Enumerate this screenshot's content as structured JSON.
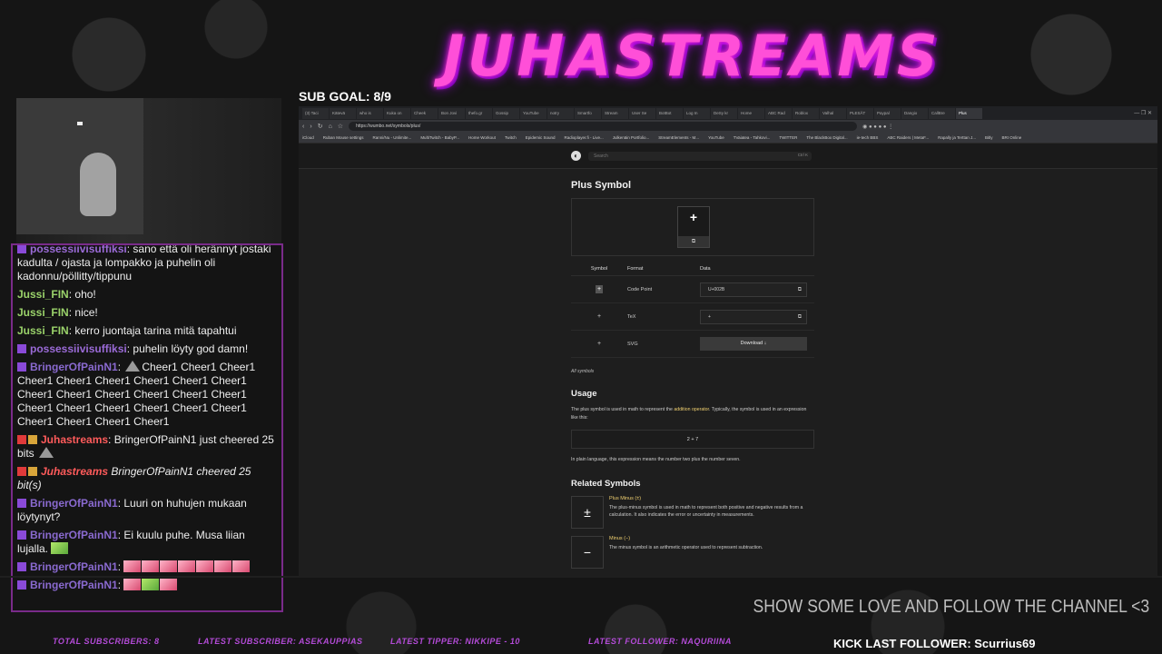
{
  "overlay": {
    "logo_text": "JUHASTREAMS",
    "sub_goal": "SUB GOAL: 8/9",
    "follow_cta": "SHOW SOME LOVE AND FOLLOW THE CHANNEL <3",
    "tickers": {
      "total_subscribers": "TOTAL SUBSCRIBERS: 8",
      "latest_subscriber": "LATEST SUBSCRIBER: ASEKAUPPIAS",
      "latest_tipper": "LATEST TIPPER: NIKKIPE - 10",
      "latest_follower": "LATEST FOLLOWER: NAQURIINA"
    },
    "kick_follower": "KICK LAST FOLLOWER: Scurrius69"
  },
  "chat": [
    {
      "user": "possessiivisuffiksi",
      "sep": ":",
      "text": "sano että oli herännyt jostaki kadulta / ojasta ja lompakko ja puhelin oli kadonnu/pöllitty/tippunu"
    },
    {
      "user": "Jussi_FIN",
      "sep": ":",
      "text": "oho!"
    },
    {
      "user": "Jussi_FIN",
      "sep": ":",
      "text": "nice!"
    },
    {
      "user": "Jussi_FIN",
      "sep": ":",
      "text": "kerro juontaja tarina mitä tapahtui"
    },
    {
      "user": "possessiivisuffiksi",
      "sep": ":",
      "text": "puhelin löyty god damn!"
    },
    {
      "user": "BringerOfPainN1",
      "sep": ":",
      "text": "Cheer1 Cheer1 Cheer1 Cheer1 Cheer1 Cheer1 Cheer1 Cheer1 Cheer1 Cheer1 Cheer1 Cheer1 Cheer1 Cheer1 Cheer1 Cheer1 Cheer1 Cheer1 Cheer1 Cheer1 Cheer1 Cheer1 Cheer1 Cheer1 Cheer1"
    },
    {
      "user": "Juhastreams",
      "sep": ":",
      "text": "BringerOfPainN1 just cheered 25 bits"
    },
    {
      "user": "Juhastreams",
      "sep": "",
      "text": "BringerOfPainN1 cheered 25 bit(s)"
    },
    {
      "user": "BringerOfPainN1",
      "sep": ":",
      "text": "Luuri on huhujen mukaan löytynyt?"
    },
    {
      "user": "BringerOfPainN1",
      "sep": ":",
      "text": "Ei kuulu puhe. Musa liian lujalla."
    },
    {
      "user": "BringerOfPainN1",
      "sep": ":",
      "text": ""
    },
    {
      "user": "BringerOfPainN1",
      "sep": ":",
      "text": ""
    }
  ],
  "browser": {
    "tabs": [
      "(3) Taci",
      "Kätevä",
      "who is",
      "Kuka on",
      "Cheek",
      "Bon Jovi",
      "thefo.gr",
      "Gossip",
      "YouTube",
      "notry",
      "Smartfo",
      "Stream",
      "User Se",
      "BotBot",
      "Log In",
      "DeSy kr",
      "Home",
      "ABC Rad",
      "Roblox",
      "Valhal",
      "PLESÄT",
      "Paypal",
      "Dangio",
      "CallBre",
      "Plus"
    ],
    "url": "https://wumbo.net/symbols/plus/",
    "window_controls": "—  ❐  ✕",
    "bookmarks": [
      "iCloud",
      "Ruban Mouse settings",
      "Ranni/Nu - Unlimite...",
      "MultiTwitch - BabyP...",
      "Home Workout",
      "Twitch",
      "Epidemic Sound",
      "Radioplayer.fi - Live...",
      "Julkenäin Portfolio...",
      "StreamElements - M...",
      "YouTube",
      "TVaiatea - Tahkovi...",
      "TWITTER",
      "The BlackBox Digital...",
      "ie-tech BBS",
      "ABC Raiders | MetaF...",
      "Rapally ja Terttan J...",
      "Bitly",
      "BRI Online"
    ],
    "site_search_placeholder": "Search",
    "site_search_shortcut": "Ctrl K",
    "page": {
      "title": "Plus Symbol",
      "preview_symbol": "+",
      "table_headers": [
        "Symbol",
        "Format",
        "Data"
      ],
      "rows": [
        {
          "symbol": "+",
          "format": "Code Point",
          "data": "U+002B",
          "kind": "input"
        },
        {
          "symbol": "+",
          "format": "TeX",
          "data": "+",
          "kind": "input"
        },
        {
          "symbol": "+",
          "format": "SVG",
          "data": "Download ↓",
          "kind": "button"
        }
      ],
      "all_symbols": "All symbols",
      "usage_heading": "Usage",
      "usage_text_1": "The plus symbol is used in math to represent the ",
      "usage_link": "addition operator",
      "usage_text_2": ". Typically, the symbol is used in an expression like this:",
      "expression": "2 + 7",
      "plain_language": "In plain language, this expression means the number two plus the number seven.",
      "related_heading": "Related Symbols",
      "related": [
        {
          "symbol": "±",
          "name": "Plus Minus (±)",
          "desc": "The plus-minus symbol is used in math to represent both positive and negative results from a calculation. It also indicates the error or uncertainty in measurements."
        },
        {
          "symbol": "−",
          "name": "Minus (−)",
          "desc": "The minus symbol is an arithmetic operator used to represent subtraction."
        }
      ]
    }
  },
  "colors": {
    "logo": "#ff4fd8",
    "chat_border": "#7a2b8a",
    "ticker": "#b44bd8",
    "link": "#f0d070"
  }
}
